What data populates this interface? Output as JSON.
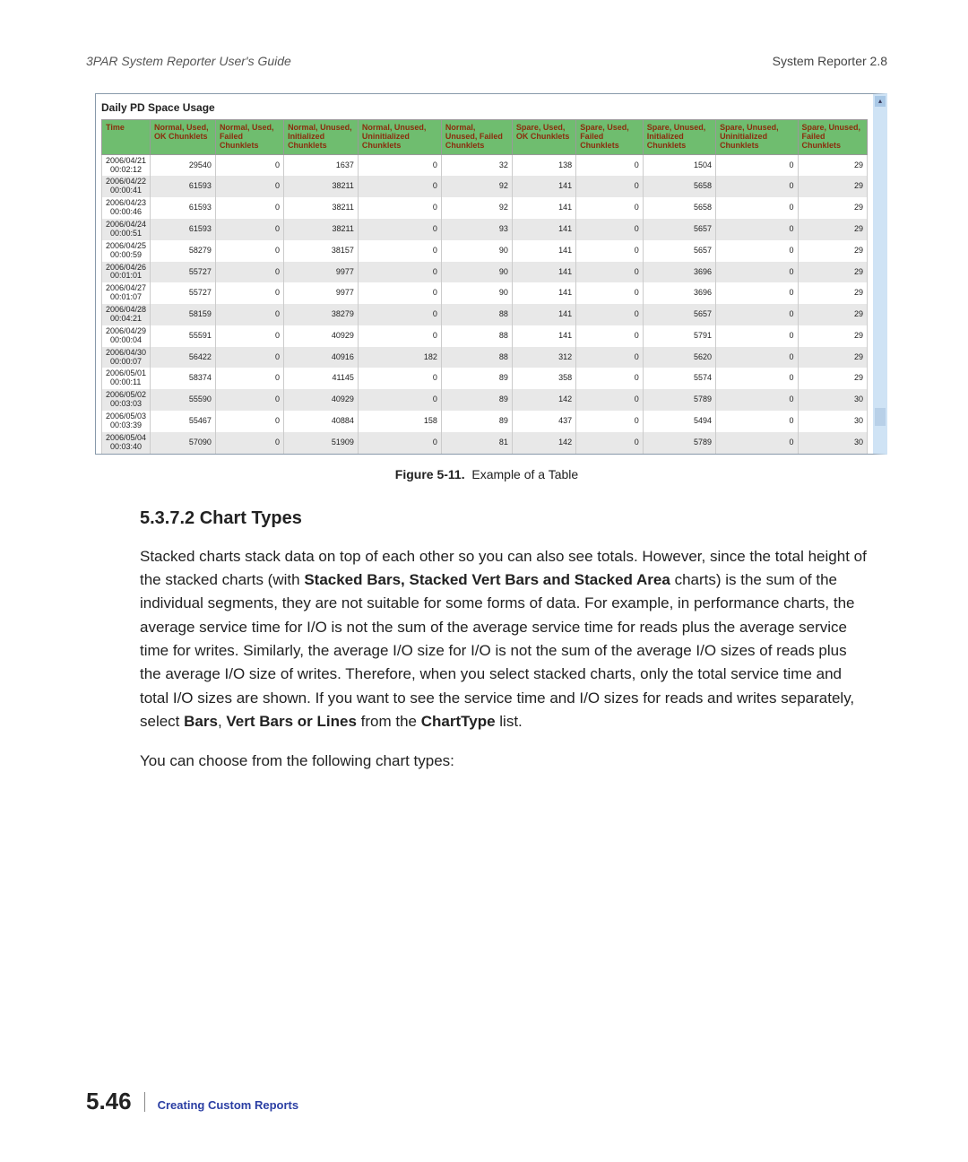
{
  "header": {
    "left": "3PAR System Reporter User's Guide",
    "right": "System Reporter 2.8"
  },
  "table_title": "Daily PD Space Usage",
  "columns": [
    "Time",
    "Normal, Used, OK Chunklets",
    "Normal, Used, Failed Chunklets",
    "Normal, Unused, Initialized Chunklets",
    "Normal, Unused, Uninitialized Chunklets",
    "Normal, Unused, Failed Chunklets",
    "Spare, Used, OK Chunklets",
    "Spare, Used, Failed Chunklets",
    "Spare, Unused, Initialized Chunklets",
    "Spare, Unused, Uninitialized Chunklets",
    "Spare, Unused, Failed Chunklets"
  ],
  "rows": [
    {
      "time": "2006/04/21\n  00:02:12",
      "c": [
        29540,
        0,
        1637,
        0,
        32,
        138,
        0,
        1504,
        0,
        29
      ]
    },
    {
      "time": "2006/04/22\n  00:00:41",
      "c": [
        61593,
        0,
        38211,
        0,
        92,
        141,
        0,
        5658,
        0,
        29
      ]
    },
    {
      "time": "2006/04/23\n  00:00:46",
      "c": [
        61593,
        0,
        38211,
        0,
        92,
        141,
        0,
        5658,
        0,
        29
      ]
    },
    {
      "time": "2006/04/24\n  00:00:51",
      "c": [
        61593,
        0,
        38211,
        0,
        93,
        141,
        0,
        5657,
        0,
        29
      ]
    },
    {
      "time": "2006/04/25\n  00:00:59",
      "c": [
        58279,
        0,
        38157,
        0,
        90,
        141,
        0,
        5657,
        0,
        29
      ]
    },
    {
      "time": "2006/04/26\n  00:01:01",
      "c": [
        55727,
        0,
        9977,
        0,
        90,
        141,
        0,
        3696,
        0,
        29
      ]
    },
    {
      "time": "2006/04/27\n  00:01:07",
      "c": [
        55727,
        0,
        9977,
        0,
        90,
        141,
        0,
        3696,
        0,
        29
      ]
    },
    {
      "time": "2006/04/28\n  00:04:21",
      "c": [
        58159,
        0,
        38279,
        0,
        88,
        141,
        0,
        5657,
        0,
        29
      ]
    },
    {
      "time": "2006/04/29\n  00:00:04",
      "c": [
        55591,
        0,
        40929,
        0,
        88,
        141,
        0,
        5791,
        0,
        29
      ]
    },
    {
      "time": "2006/04/30\n  00:00:07",
      "c": [
        56422,
        0,
        40916,
        182,
        88,
        312,
        0,
        5620,
        0,
        29
      ]
    },
    {
      "time": "2006/05/01\n  00:00:11",
      "c": [
        58374,
        0,
        41145,
        0,
        89,
        358,
        0,
        5574,
        0,
        29
      ]
    },
    {
      "time": "2006/05/02\n  00:03:03",
      "c": [
        55590,
        0,
        40929,
        0,
        89,
        142,
        0,
        5789,
        0,
        30
      ]
    },
    {
      "time": "2006/05/03\n  00:03:39",
      "c": [
        55467,
        0,
        40884,
        158,
        89,
        437,
        0,
        5494,
        0,
        30
      ]
    },
    {
      "time": "2006/05/04\n  00:03:40",
      "c": [
        57090,
        0,
        51909,
        0,
        81,
        142,
        0,
        5789,
        0,
        30
      ]
    }
  ],
  "figcap": {
    "label": "Figure 5-11.",
    "text": "Example of a Table"
  },
  "section_heading": "5.3.7.2 Chart Types",
  "paragraphs": {
    "p1a": "Stacked charts stack data on top of each other so you can also see totals. However, since the total height of the stacked charts (with ",
    "p1b_bold": "Stacked Bars, Stacked Vert Bars and Stacked Area",
    "p1c": " charts) is the sum of the individual segments, they are not suitable for some forms of data. For example, in performance charts, the average service time for I/O is not the sum of the average service time for reads plus the average service time for writes. Similarly, the average I/O size for I/O is not the sum of the average I/O sizes of reads plus the average I/O size of writes. Therefore, when you select stacked charts, only the total service time and total I/O sizes are shown. If you want to see the service time and I/O sizes for reads and writes separately, select ",
    "p1d_bold": "Bars",
    "p1e": ", ",
    "p1f_bold": "Vert Bars or Lines",
    "p1g": " from the ",
    "p1h_bold": "ChartType",
    "p1i": " list.",
    "p2": "You can choose from the following chart types:"
  },
  "footer": {
    "page": "5.46",
    "section": "Creating Custom Reports"
  }
}
